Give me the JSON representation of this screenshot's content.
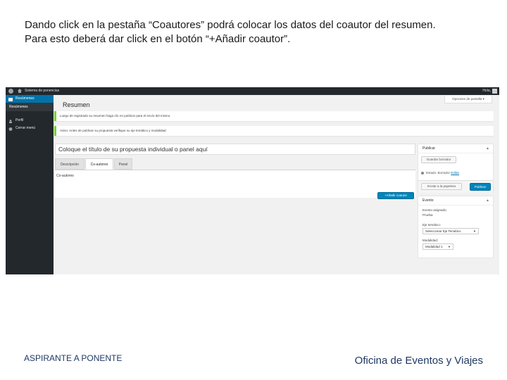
{
  "slide": {
    "instruction_line1": "Dando click en la pestaña “Coautores” podrá colocar los datos del coautor del resumen.",
    "instruction_line2": "Para esto deberá dar click en el botón “+Añadir coautor”.",
    "footer_left": "ASPIRANTE A PONENTE",
    "footer_right": "Oficina de Eventos y Viajes"
  },
  "adminbar": {
    "site_name": "Sistema de ponencias",
    "greeting": "Hola, ",
    "colors": {
      "background": "#23282d"
    }
  },
  "sidebar": {
    "items": [
      {
        "label": "Resúmenes",
        "icon": "document-icon",
        "state": "active"
      },
      {
        "label": "Resúmenes",
        "icon": "",
        "state": "submenu-current"
      },
      {
        "label": "Perfil",
        "icon": "user-icon",
        "state": "normal"
      },
      {
        "label": "Cerrar menú",
        "icon": "collapse-icon",
        "state": "normal"
      }
    ]
  },
  "main": {
    "screen_options": "Opciones de pantalla ▾",
    "title": "Resumen",
    "notices": [
      "Luego de registrado su resumen haga clic en publicar para el envío del mismo.",
      "Aviso: Antes de publicar su propuesta verifique su eje temático y modalidad."
    ],
    "title_placeholder": "Coloque el título de su propuesta individual o panel aquí",
    "tabs": [
      "Descripción",
      "Co-autores",
      "Panel"
    ],
    "active_tab": "Co-autores",
    "coauthors_label": "Co-autores",
    "add_coauthor_button": "+Añadir coautor"
  },
  "publish_box": {
    "title": "Publicar",
    "toggle": "▲",
    "save_draft": "Guardar borrador",
    "status_label": "Estado: ",
    "status_value": "Borrador",
    "status_edit": "Editar",
    "move_to_trash": "Enviar a la papelera",
    "publish_button": "Publicar"
  },
  "event_box": {
    "title": "Evento",
    "toggle": "▲",
    "event_label": "Evento asignado:",
    "event_value": "Prueba",
    "theme_label": "Eje temático:",
    "theme_value": "Seleccionar Eje Temático",
    "modality_label": "Modalidad:",
    "modality_value": "Modalidad 1"
  },
  "colors": {
    "accent": "#0085ba",
    "notice_border": "#7ad03a",
    "footer_text": "#1f3864"
  }
}
